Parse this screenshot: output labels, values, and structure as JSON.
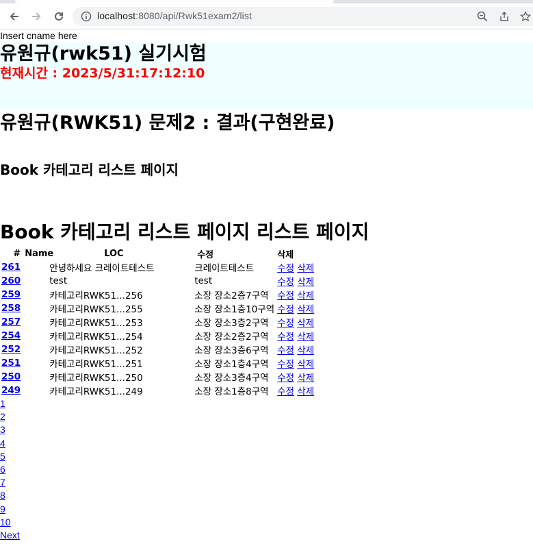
{
  "browser": {
    "url_host": "localhost",
    "url_path": ":8080/api/Rwk51exam2/list"
  },
  "page": {
    "cname_text": "Insert cname here",
    "title": "유원규(rwk51) 실기시험",
    "clock": "현재시간 : 2023/5/31:17:12:10",
    "subtitle": "유원규(RWK51) 문제2 : 결과(구현완료)",
    "section_title": "Book 카테고리 리스트 페이지",
    "list_title": "Book 카테고리 리스트 페이지 리스트 페이지"
  },
  "table": {
    "headers": [
      "#",
      "Name",
      "LOC",
      "수정",
      "삭제"
    ],
    "rows": [
      {
        "id": "261",
        "name": "안녕하세요 크레이트테스트",
        "loc": "크레이트테스트",
        "edit": "수정",
        "del": "삭제"
      },
      {
        "id": "260",
        "name": "test",
        "loc": "test",
        "edit": "수정",
        "del": "삭제"
      },
      {
        "id": "259",
        "name": "카테고리RWK51...256",
        "loc": "소장 장소2층7구역",
        "edit": "수정",
        "del": "삭제"
      },
      {
        "id": "258",
        "name": "카테고리RWK51...255",
        "loc": "소장 장소1층10구역",
        "edit": "수정",
        "del": "삭제"
      },
      {
        "id": "257",
        "name": "카테고리RWK51...253",
        "loc": "소장 장소3층2구역",
        "edit": "수정",
        "del": "삭제"
      },
      {
        "id": "254",
        "name": "카테고리RWK51...254",
        "loc": "소장 장소2층2구역",
        "edit": "수정",
        "del": "삭제"
      },
      {
        "id": "252",
        "name": "카테고리RWK51...252",
        "loc": "소장 장소3층6구역",
        "edit": "수정",
        "del": "삭제"
      },
      {
        "id": "251",
        "name": "카테고리RWK51...251",
        "loc": "소장 장소1층4구역",
        "edit": "수정",
        "del": "삭제"
      },
      {
        "id": "250",
        "name": "카테고리RWK51...250",
        "loc": "소장 장소3층4구역",
        "edit": "수정",
        "del": "삭제"
      },
      {
        "id": "249",
        "name": "카테고리RWK51...249",
        "loc": "소장 장소1층8구역",
        "edit": "수정",
        "del": "삭제"
      }
    ]
  },
  "pager": {
    "pages": [
      "1",
      "2",
      "3",
      "4",
      "5",
      "6",
      "7",
      "8",
      "9",
      "10"
    ],
    "next_label": "Next"
  }
}
